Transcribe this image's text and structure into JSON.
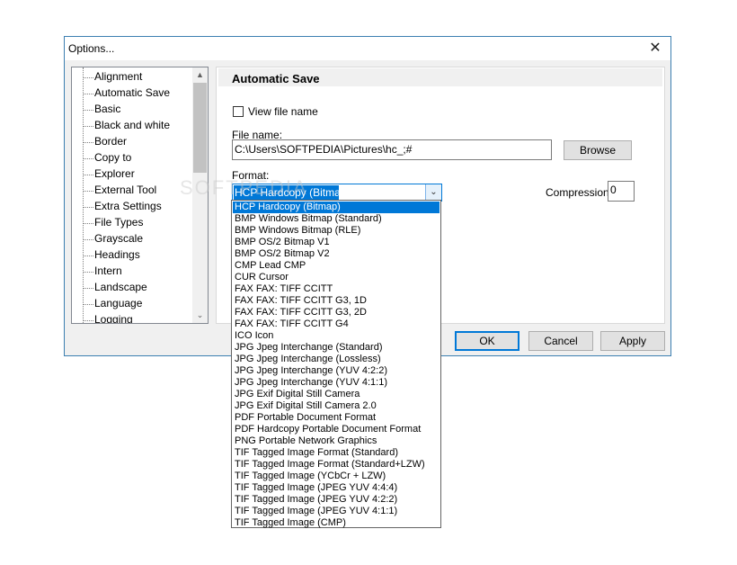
{
  "window": {
    "title": "Options...",
    "close_icon": "close-icon",
    "close_glyph": "✕"
  },
  "sidebar": {
    "items": [
      {
        "label": "Alignment"
      },
      {
        "label": "Automatic Save"
      },
      {
        "label": "Basic"
      },
      {
        "label": "Black and white"
      },
      {
        "label": "Border"
      },
      {
        "label": "Copy to"
      },
      {
        "label": "Explorer"
      },
      {
        "label": "External Tool"
      },
      {
        "label": "Extra Settings"
      },
      {
        "label": "File Types"
      },
      {
        "label": "Grayscale"
      },
      {
        "label": "Headings"
      },
      {
        "label": "Intern"
      },
      {
        "label": "Landscape"
      },
      {
        "label": "Language"
      },
      {
        "label": "Logging"
      }
    ],
    "scroll_up_glyph": "▲",
    "scroll_down_glyph": "⌄"
  },
  "panel": {
    "title": "Automatic Save",
    "view_file_name_label": "View file name",
    "file_name_label": "File name:",
    "file_name_value": "C:\\Users\\SOFTPEDIA\\Pictures\\hc_;#",
    "browse_label": "Browse",
    "format_label": "Format:",
    "format_value": "HCP  Hardcopy (Bitmap)",
    "format_arrow": "⌄",
    "compression_label": "Compression:",
    "compression_value": "0"
  },
  "buttons": {
    "ok": "OK",
    "cancel": "Cancel",
    "apply": "Apply"
  },
  "format_options": [
    "HCP  Hardcopy (Bitmap)",
    "BMP  Windows Bitmap (Standard)",
    "BMP  Windows Bitmap (RLE)",
    "BMP  OS/2 Bitmap V1",
    "BMP  OS/2 Bitmap V2",
    "CMP  Lead CMP",
    "CUR  Cursor",
    "FAX  FAX: TIFF CCITT",
    "FAX  FAX: TIFF CCITT G3, 1D",
    "FAX  FAX: TIFF CCITT G3, 2D",
    "FAX  FAX: TIFF CCITT G4",
    "ICO  Icon",
    "JPG  Jpeg Interchange (Standard)",
    "JPG  Jpeg Interchange (Lossless)",
    "JPG  Jpeg Interchange (YUV 4:2:2)",
    "JPG  Jpeg Interchange (YUV 4:1:1)",
    "JPG  Exif Digital Still Camera",
    "JPG  Exif Digital Still Camera 2.0",
    "PDF  Portable Document Format",
    "PDF  Hardcopy Portable Document Format",
    "PNG  Portable Network Graphics",
    "TIF  Tagged Image Format (Standard)",
    "TIF  Tagged Image Format (Standard+LZW)",
    "TIF  Tagged Image (YCbCr + LZW)",
    "TIF  Tagged Image (JPEG YUV 4:4:4)",
    "TIF  Tagged Image (JPEG YUV 4:2:2)",
    "TIF  Tagged Image (JPEG YUV 4:1:1)",
    "TIF  Tagged Image (CMP)"
  ],
  "watermark": "SOFTPEDIA"
}
